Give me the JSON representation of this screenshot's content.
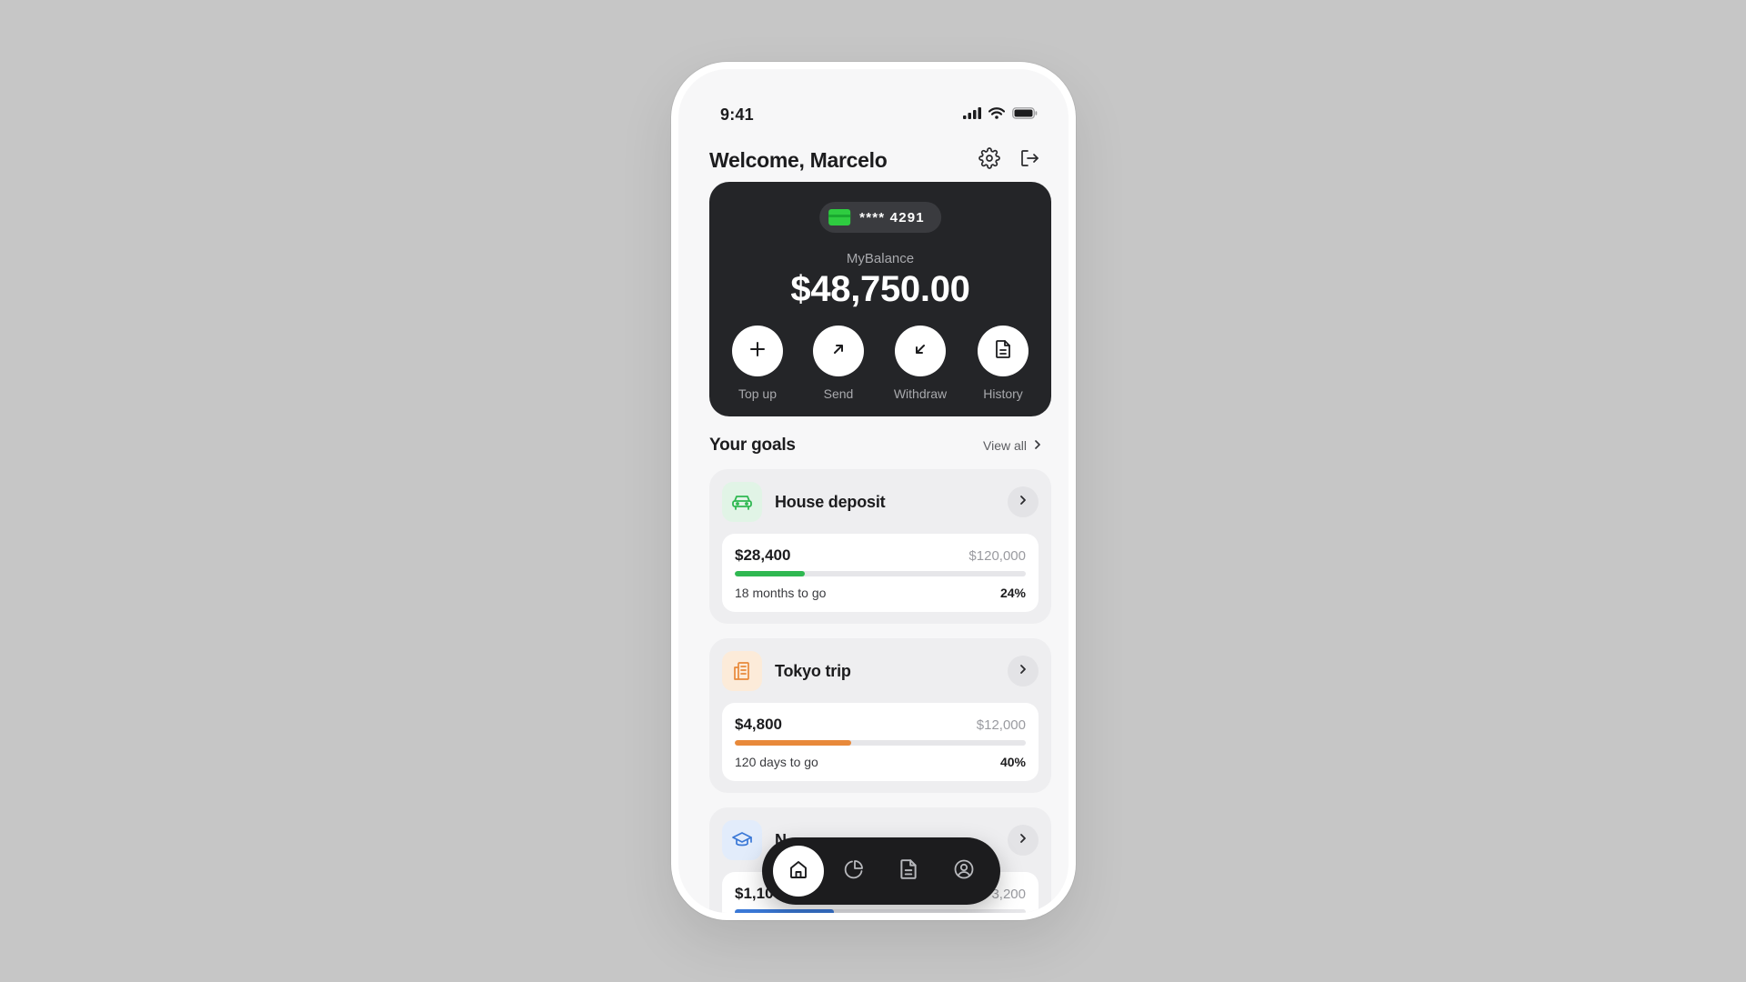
{
  "status": {
    "time": "9:41"
  },
  "header": {
    "welcome": "Welcome, Marcelo"
  },
  "card": {
    "number": "**** 4291",
    "balance_label": "MyBalance",
    "balance": "$48,750.00",
    "actions": [
      {
        "label": "Top up",
        "icon": "plus-icon"
      },
      {
        "label": "Send",
        "icon": "arrow-up-right-icon"
      },
      {
        "label": "Withdraw",
        "icon": "arrow-down-left-icon"
      },
      {
        "label": "History",
        "icon": "document-icon"
      }
    ]
  },
  "goals": {
    "title": "Your goals",
    "view_all": "View all",
    "items": [
      {
        "name": "House deposit",
        "icon": "car-icon",
        "saved": "$28,400",
        "target": "$120,000",
        "time_left": "18 months to go",
        "percent": "24%",
        "progress": 0.24,
        "color": "#2fb851",
        "icon_bg": "#e1f4e6"
      },
      {
        "name": "Tokyo trip",
        "icon": "building-icon",
        "saved": "$4,800",
        "target": "$12,000",
        "time_left": "120 days to go",
        "percent": "40%",
        "progress": 0.4,
        "color": "#e8893a",
        "icon_bg": "#fcebd9"
      },
      {
        "name": "N",
        "icon": "graduation-cap-icon",
        "saved": "$1,10",
        "target": "3,200",
        "progress": 0.34,
        "color": "#3a78d6",
        "icon_bg": "#e2ecfb"
      }
    ]
  },
  "tabbar": {
    "tabs": [
      {
        "icon": "home-icon",
        "active": true
      },
      {
        "icon": "pie-chart-icon",
        "active": false
      },
      {
        "icon": "document-icon",
        "active": false
      },
      {
        "icon": "profile-icon",
        "active": false
      }
    ]
  }
}
